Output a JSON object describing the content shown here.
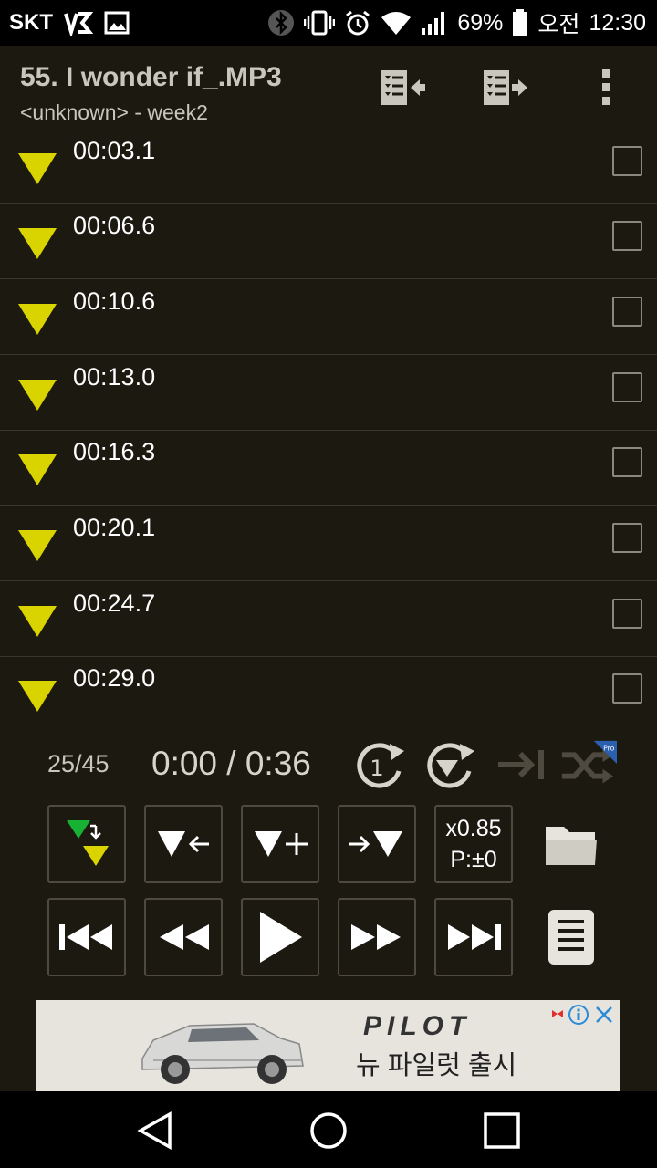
{
  "status_bar": {
    "carrier": "SKT",
    "battery": "69%",
    "time_prefix": "오전",
    "time": "12:30",
    "icons": [
      "lte-icon",
      "image-icon",
      "bluetooth-icon",
      "vibrate-icon",
      "alarm-icon",
      "wifi-icon",
      "signal-icon",
      "battery-icon"
    ]
  },
  "header": {
    "title": "55. I wonder if_.MP3",
    "subtitle": "<unknown> - week2",
    "actions": [
      "import-bookmarks-icon",
      "export-bookmarks-icon",
      "more-vert-icon"
    ]
  },
  "bookmarks": [
    {
      "time": "00:03.1",
      "checked": false
    },
    {
      "time": "00:06.6",
      "checked": false
    },
    {
      "time": "00:10.6",
      "checked": false
    },
    {
      "time": "00:13.0",
      "checked": false
    },
    {
      "time": "00:16.3",
      "checked": false
    },
    {
      "time": "00:20.1",
      "checked": false
    },
    {
      "time": "00:24.7",
      "checked": false
    },
    {
      "time": "00:29.0",
      "checked": false
    }
  ],
  "colors": {
    "marker": "#d9d300",
    "marker_green": "#17b233",
    "background": "#1c1911"
  },
  "player": {
    "counter": "25/45",
    "position": "0:00",
    "duration": "0:36",
    "timer_text": "0:00 / 0:36",
    "repeat_one_label": "1",
    "pro_badge": "Pro",
    "speed_label": "x0.85",
    "pitch_label": "P:±0"
  },
  "ad": {
    "brand": "PILOT",
    "tagline": "뉴 파일럿 출시"
  }
}
